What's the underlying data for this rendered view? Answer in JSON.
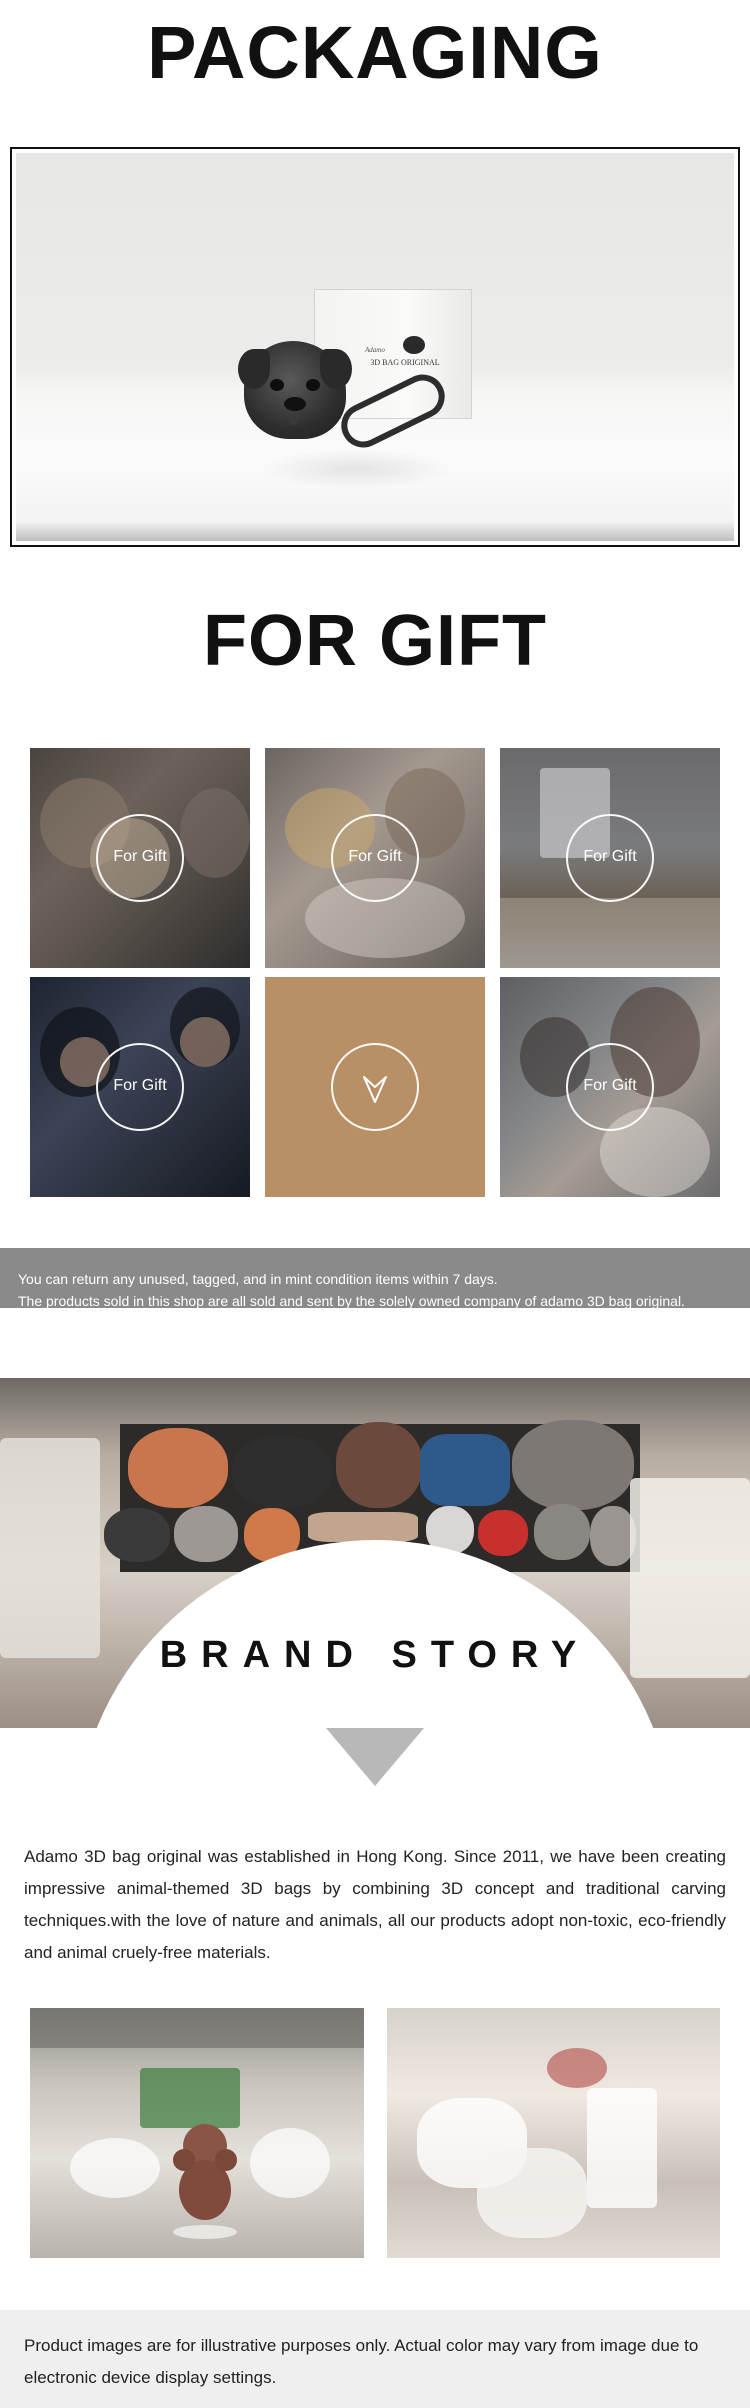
{
  "packaging": {
    "title": "PACKAGING",
    "box_brand": "3D BAG ORIGINAL",
    "box_script": "Adamo"
  },
  "gift": {
    "title": "FOR GIFT",
    "tiles": [
      {
        "label": "For Gift"
      },
      {
        "label": "For Gift"
      },
      {
        "label": "For Gift"
      },
      {
        "label": "For Gift"
      },
      {
        "label": ""
      },
      {
        "label": "For Gift"
      }
    ]
  },
  "policy": {
    "line1": "You can return any unused, tagged, and in mint condition items within 7 days.",
    "line2": "The products sold in this shop are all sold and sent by the solely owned company of adamo 3D bag original."
  },
  "brand_story": {
    "title": "BRAND STORY",
    "text": "Adamo 3D bag original was established in Hong Kong. Since 2011, we have been creating impressive animal-themed 3D bags by combining 3D concept and traditional carving techniques.with the love of nature and animals, all our products adopt non-toxic, eco-friendly and animal cruely-free materials."
  },
  "disclaimer": {
    "text": "Product images are for illustrative purposes only. Actual color may vary from image due to electronic device display settings."
  },
  "colors": {
    "policy_bar": "#8a8a8a",
    "tile_accent": "#b99066",
    "triangle": "#b8b8b8",
    "disclaimer_bg": "#efefef"
  },
  "icons": {
    "tile_center": "chevron-down-icon"
  }
}
